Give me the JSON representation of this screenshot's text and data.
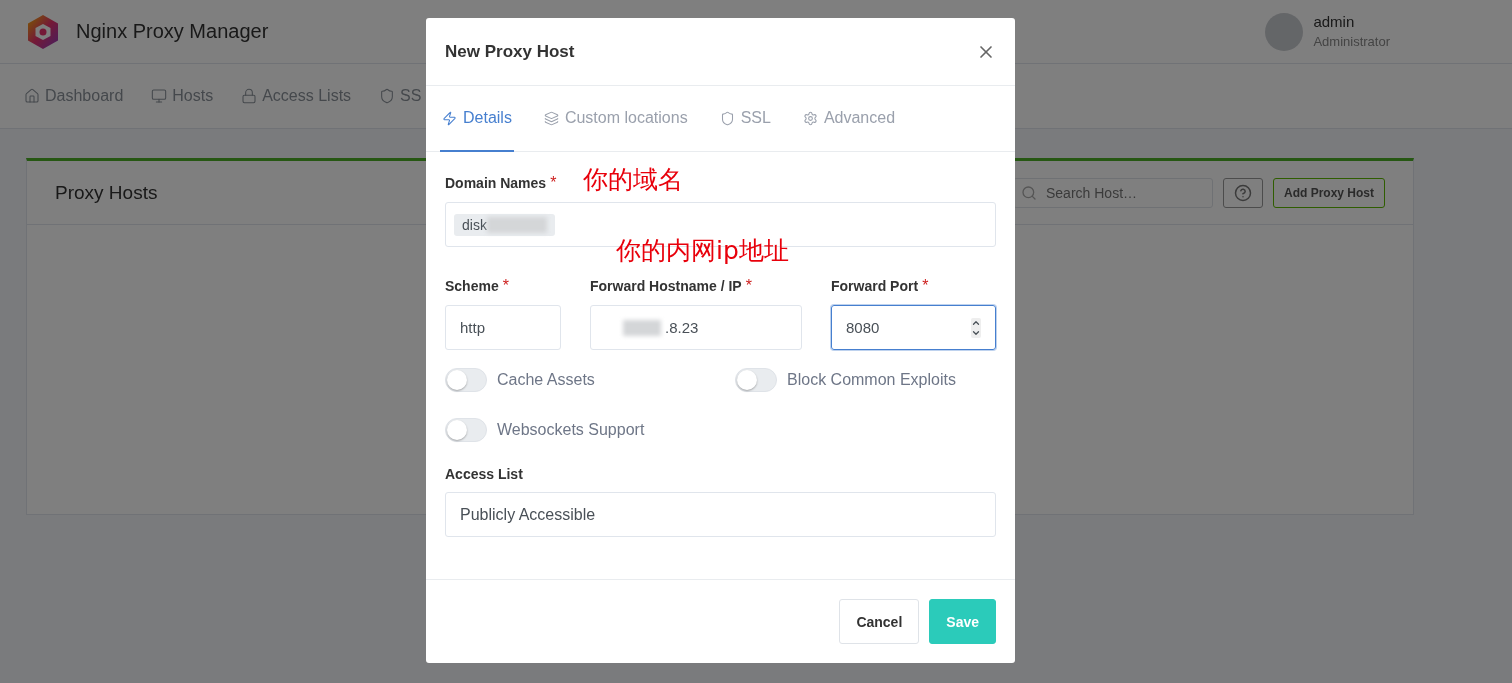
{
  "app": {
    "title": "Nginx Proxy Manager",
    "user": {
      "name": "admin",
      "role": "Administrator"
    }
  },
  "nav": [
    {
      "label": "Dashboard"
    },
    {
      "label": "Hosts"
    },
    {
      "label": "Access Lists"
    },
    {
      "label": "SS"
    }
  ],
  "card": {
    "title": "Proxy Hosts",
    "search": {
      "placeholder": "Search Host…"
    },
    "add_button": "Add Proxy Host"
  },
  "modal": {
    "title": "New Proxy Host",
    "tabs": [
      {
        "label": "Details",
        "selected": true
      },
      {
        "label": "Custom locations",
        "selected": false
      },
      {
        "label": "SSL",
        "selected": false
      },
      {
        "label": "Advanced",
        "selected": false
      }
    ],
    "domain": {
      "label": "Domain Names",
      "mark": "*",
      "tags": [
        "disk"
      ]
    },
    "annotations": [
      "你的域名",
      "你的内网ip地址"
    ],
    "fields": [
      {
        "label": "Scheme",
        "mark": "*",
        "value": "http",
        "kind": "text",
        "focused": false,
        "redacted": false
      },
      {
        "label": "Forward Hostname / IP",
        "mark": "*",
        "value": ".8.23",
        "kind": "text",
        "focused": false,
        "redacted": true
      },
      {
        "label": "Forward Port",
        "mark": "*",
        "value": "8080",
        "kind": "number",
        "focused": true,
        "redacted": false
      }
    ],
    "switches": [
      {
        "label": "Cache Assets",
        "on": false
      },
      {
        "label": "Block Common Exploits",
        "on": false
      },
      {
        "label": "Websockets Support",
        "on": false
      }
    ],
    "access_list": {
      "label": "Access List",
      "value": "Publicly Accessible"
    },
    "buttons": [
      {
        "label": "Cancel",
        "kind": "secondary"
      },
      {
        "label": "Save",
        "kind": "primary"
      }
    ]
  }
}
